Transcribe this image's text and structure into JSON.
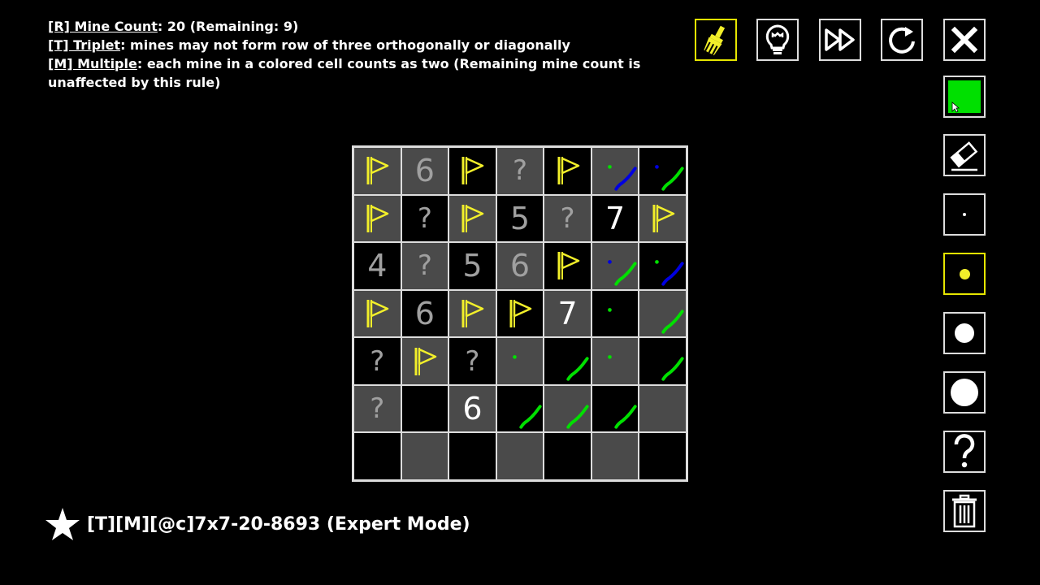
{
  "rules": [
    {
      "key": "[R] Mine Count",
      "text": ":  20 (Remaining: 9)"
    },
    {
      "key": "[T] Triplet",
      "text": ": mines may not form row of three orthogonally or diagonally"
    },
    {
      "key": "[M] Multiple",
      "text": ": each mine in a colored cell counts as two (Remaining mine count is unaffected by this rule)"
    }
  ],
  "toolbar": {
    "top": [
      "paintbrush-icon",
      "lightbulb-icon",
      "fast-forward-icon",
      "restart-icon",
      "close-icon"
    ],
    "side": [
      "green-swatch",
      "eraser-icon",
      "dot-tiny",
      "dot-yellow",
      "dot-medium",
      "dot-large",
      "question-icon",
      "trash-icon"
    ]
  },
  "colors": {
    "flag": "#f2ef2a",
    "green": "#00e000",
    "blue": "#0000e0",
    "active": "#e6e600"
  },
  "board": {
    "size": 7,
    "cells": [
      [
        {
          "t": "flag",
          "bg": 1
        },
        {
          "t": "6",
          "bg": 1,
          "style": "gray"
        },
        {
          "t": "flag",
          "bg": 0
        },
        {
          "t": "?",
          "bg": 1
        },
        {
          "t": "flag",
          "bg": 0
        },
        {
          "t": "mark",
          "bg": 1,
          "dot": "green",
          "stroke": "blue"
        },
        {
          "t": "mark",
          "bg": 0,
          "dot": "blue",
          "stroke": "green"
        }
      ],
      [
        {
          "t": "flag",
          "bg": 1
        },
        {
          "t": "?",
          "bg": 0
        },
        {
          "t": "flag",
          "bg": 1
        },
        {
          "t": "5",
          "bg": 0,
          "style": "gray"
        },
        {
          "t": "?",
          "bg": 1
        },
        {
          "t": "7",
          "bg": 0,
          "style": "white"
        },
        {
          "t": "flag",
          "bg": 1
        }
      ],
      [
        {
          "t": "4",
          "bg": 0,
          "style": "gray"
        },
        {
          "t": "?",
          "bg": 1
        },
        {
          "t": "5",
          "bg": 0,
          "style": "gray"
        },
        {
          "t": "6",
          "bg": 1,
          "style": "gray"
        },
        {
          "t": "flag",
          "bg": 0
        },
        {
          "t": "mark",
          "bg": 1,
          "dot": "blue",
          "stroke": "green"
        },
        {
          "t": "mark",
          "bg": 0,
          "dot": "green",
          "stroke": "blue"
        }
      ],
      [
        {
          "t": "flag",
          "bg": 1
        },
        {
          "t": "6",
          "bg": 0,
          "style": "gray"
        },
        {
          "t": "flag",
          "bg": 1
        },
        {
          "t": "flag",
          "bg": 0
        },
        {
          "t": "7",
          "bg": 1,
          "style": "white"
        },
        {
          "t": "mark",
          "bg": 0,
          "dot": "green"
        },
        {
          "t": "mark",
          "bg": 1,
          "stroke": "green"
        }
      ],
      [
        {
          "t": "?",
          "bg": 0
        },
        {
          "t": "flag",
          "bg": 1
        },
        {
          "t": "?",
          "bg": 0
        },
        {
          "t": "mark",
          "bg": 1,
          "dot": "green"
        },
        {
          "t": "mark",
          "bg": 0,
          "stroke": "green"
        },
        {
          "t": "mark",
          "bg": 1,
          "dot": "green"
        },
        {
          "t": "mark",
          "bg": 0,
          "stroke": "green"
        }
      ],
      [
        {
          "t": "?",
          "bg": 1
        },
        {
          "t": "",
          "bg": 0
        },
        {
          "t": "6",
          "bg": 1,
          "style": "white"
        },
        {
          "t": "mark",
          "bg": 0,
          "stroke": "green"
        },
        {
          "t": "mark",
          "bg": 1,
          "stroke": "green"
        },
        {
          "t": "mark",
          "bg": 0,
          "stroke": "green"
        },
        {
          "t": "",
          "bg": 1
        }
      ],
      [
        {
          "t": "",
          "bg": 0
        },
        {
          "t": "",
          "bg": 1
        },
        {
          "t": "",
          "bg": 0
        },
        {
          "t": "",
          "bg": 1
        },
        {
          "t": "",
          "bg": 0
        },
        {
          "t": "",
          "bg": 1
        },
        {
          "t": "",
          "bg": 0
        }
      ]
    ]
  },
  "footer": {
    "title": "[T][M][@c]7x7-20-8693 (Expert Mode)"
  }
}
